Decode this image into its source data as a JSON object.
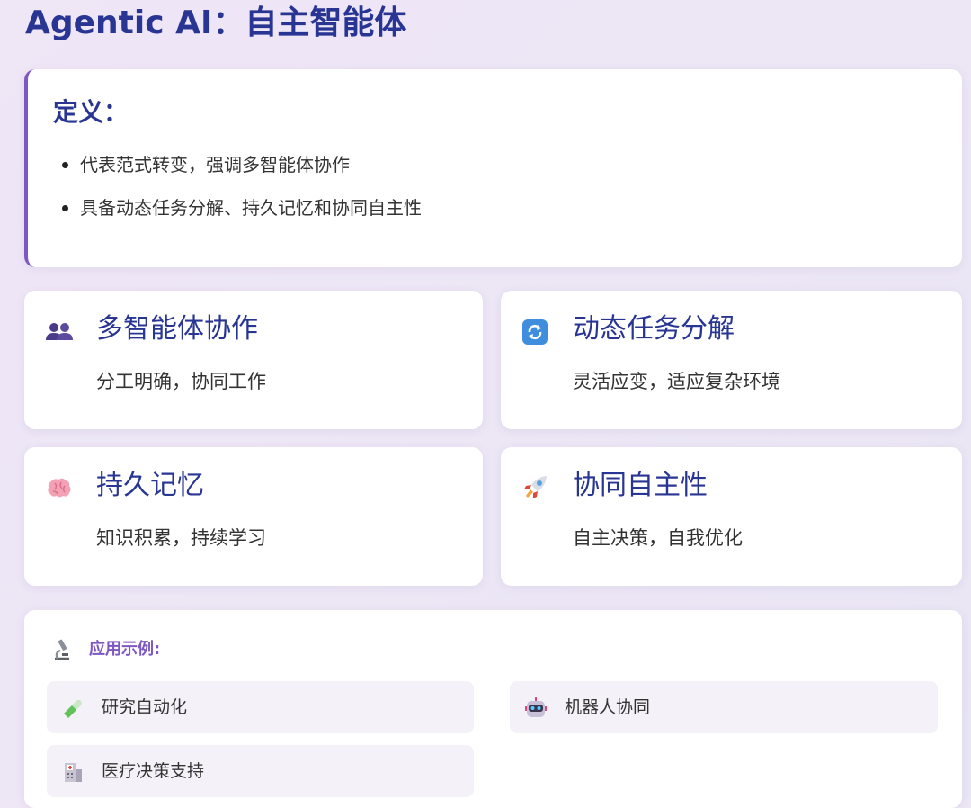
{
  "page_title": "Agentic AI：自主智能体",
  "definition": {
    "title": "定义：",
    "items": [
      "代表范式转变，强调多智能体协作",
      "具备动态任务分解、持久记忆和协同自主性"
    ]
  },
  "features": [
    {
      "icon": "people-icon",
      "title": "多智能体协作",
      "desc": "分工明确，协同工作"
    },
    {
      "icon": "refresh-icon",
      "title": "动态任务分解",
      "desc": "灵活应变，适应复杂环境"
    },
    {
      "icon": "brain-icon",
      "title": "持久记忆",
      "desc": "知识积累，持续学习"
    },
    {
      "icon": "rocket-icon",
      "title": "协同自主性",
      "desc": "自主决策，自我优化"
    }
  ],
  "applications": {
    "icon": "microscope-icon",
    "title": "应用示例:",
    "items": [
      {
        "icon": "test-tube-icon",
        "label": "研究自动化"
      },
      {
        "icon": "robot-icon",
        "label": "机器人协同"
      },
      {
        "icon": "hospital-icon",
        "label": "医疗决策支持"
      }
    ]
  },
  "colors": {
    "heading": "#283593",
    "accent": "#7e57c2",
    "card": "#ffffff",
    "app_item_bg": "#f4f1f9"
  }
}
